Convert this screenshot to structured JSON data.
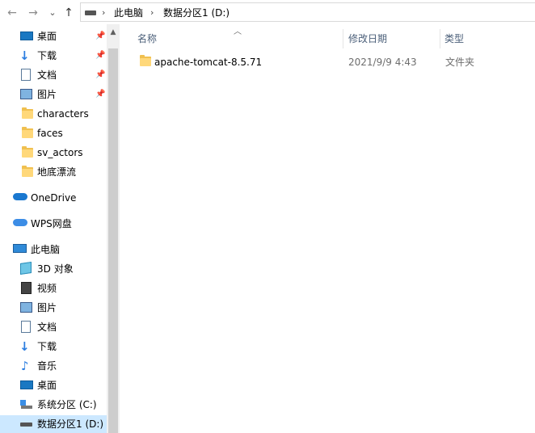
{
  "address": {
    "crumbs": [
      "此电脑",
      "数据分区1 (D:)"
    ],
    "back_glyph": "←",
    "forward_glyph": "→",
    "history_glyph": "⌄",
    "up_glyph": "↑",
    "sep_glyph": "›"
  },
  "sidebar": {
    "quick": [
      {
        "label": "桌面",
        "icon": "desktop-icon",
        "pinned": true
      },
      {
        "label": "下载",
        "icon": "download-icon",
        "pinned": true
      },
      {
        "label": "文档",
        "icon": "document-icon",
        "pinned": true
      },
      {
        "label": "图片",
        "icon": "picture-icon",
        "pinned": true
      },
      {
        "label": "characters",
        "icon": "folder-icon",
        "pinned": false
      },
      {
        "label": "faces",
        "icon": "folder-icon",
        "pinned": false
      },
      {
        "label": "sv_actors",
        "icon": "folder-icon",
        "pinned": false
      },
      {
        "label": "地底漂流",
        "icon": "folder-icon",
        "pinned": false
      }
    ],
    "onedrive": "OneDrive",
    "wps": "WPS网盘",
    "thispc": "此电脑",
    "pc_items": [
      {
        "label": "3D 对象",
        "icon": "3d-objects-icon"
      },
      {
        "label": "视频",
        "icon": "video-icon"
      },
      {
        "label": "图片",
        "icon": "picture-icon"
      },
      {
        "label": "文档",
        "icon": "document-icon"
      },
      {
        "label": "下载",
        "icon": "download-icon"
      },
      {
        "label": "音乐",
        "icon": "music-icon"
      },
      {
        "label": "桌面",
        "icon": "desktop-icon"
      },
      {
        "label": "系统分区 (C:)",
        "icon": "drive-c-icon"
      },
      {
        "label": "数据分区1 (D:)",
        "icon": "drive-d-icon",
        "selected": true
      }
    ]
  },
  "columns": {
    "name": "名称",
    "modified": "修改日期",
    "type": "类型"
  },
  "files": [
    {
      "name": "apache-tomcat-8.5.71",
      "modified": "2021/9/9 4:43",
      "type": "文件夹"
    }
  ],
  "colors": {
    "header_text": "#4c607a",
    "selected_bg": "#cce8ff",
    "folder": "#ffd87a",
    "meta_text": "#6d6d6d"
  }
}
